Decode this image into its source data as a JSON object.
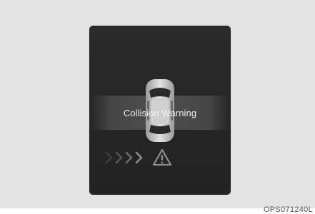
{
  "display": {
    "message": "Collision Warning",
    "icons": {
      "car": "car-top-view-icon",
      "approach": "chevron-right-icon",
      "warning": "warning-triangle-icon"
    },
    "colors": {
      "panel": "#222222",
      "band": "#4e4e4e",
      "text": "#f0f0f0",
      "background": "#e3e3e3"
    }
  },
  "figure_code": "OPS071240L"
}
